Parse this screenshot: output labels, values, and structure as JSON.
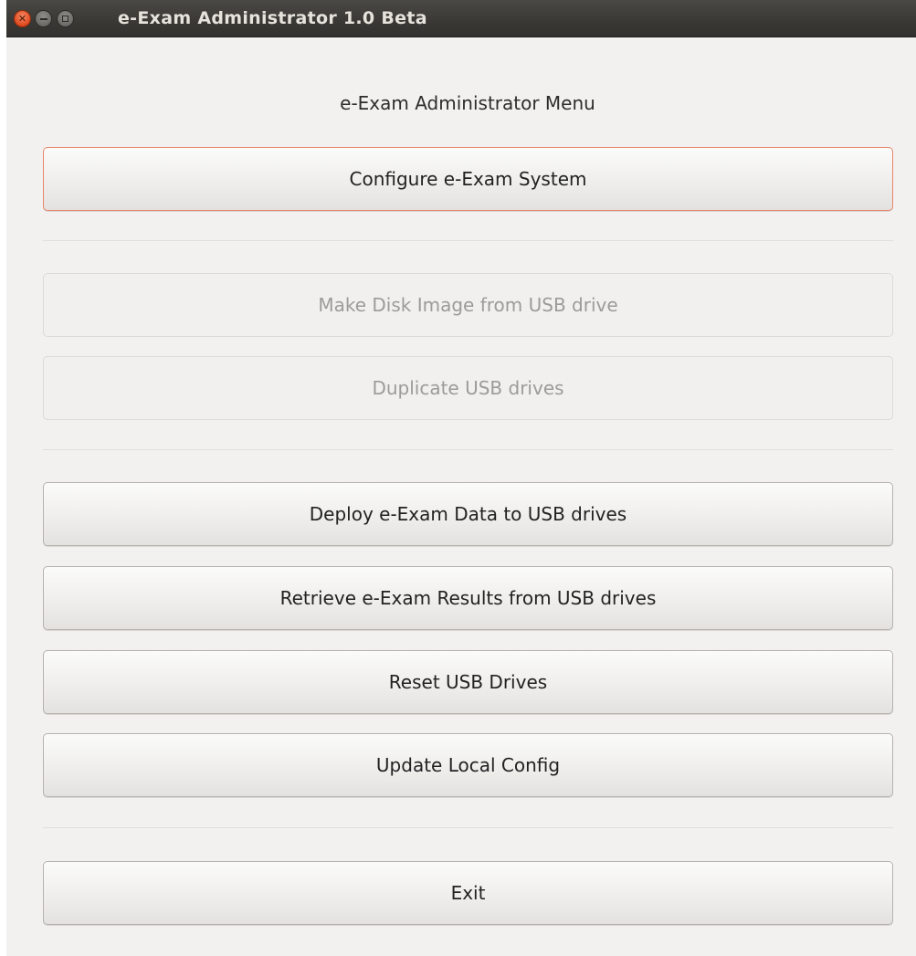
{
  "window": {
    "title": "e-Exam Administrator 1.0 Beta"
  },
  "menu": {
    "heading": "e-Exam Administrator Menu",
    "configure_label": "Configure e-Exam System",
    "make_disk_image_label": "Make Disk Image from USB drive",
    "duplicate_label": "Duplicate USB drives",
    "deploy_label": "Deploy e-Exam Data to USB drives",
    "retrieve_label": "Retrieve e-Exam Results from USB drives",
    "reset_label": "Reset USB Drives",
    "update_label": "Update Local Config",
    "exit_label": "Exit"
  },
  "colors": {
    "focus_border": "#e9866b",
    "close_button": "#df4a20",
    "titlebar": "#3a3835",
    "window_bg": "#f2f1f0",
    "disabled_text": "#9d9b98"
  },
  "icons": {
    "close": "close-icon",
    "minimize": "minimize-icon",
    "maximize": "maximize-icon"
  }
}
